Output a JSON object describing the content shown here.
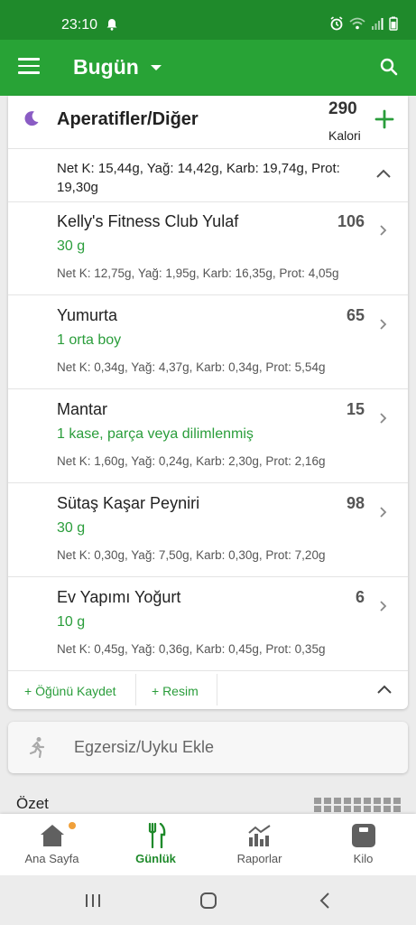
{
  "status_bar": {
    "time": "23:10"
  },
  "app_bar": {
    "title": "Bugün"
  },
  "meal": {
    "name": "Aperatifler/Diğer",
    "calories": "290",
    "calories_unit": "Kalori",
    "summary": "Net K: 15,44g, Yağ: 14,42g, Karb: 19,74g, Prot: 19,30g",
    "items": [
      {
        "name": "Kelly's Fitness Club Yulaf",
        "calories": "106",
        "quantity": "30  g",
        "macros": "Net K: 12,75g, Yağ: 1,95g, Karb: 16,35g, Prot: 4,05g"
      },
      {
        "name": "Yumurta",
        "calories": "65",
        "quantity": "1  orta boy",
        "macros": "Net K: 0,34g, Yağ: 4,37g, Karb: 0,34g, Prot: 5,54g"
      },
      {
        "name": "Mantar",
        "calories": "15",
        "quantity": "1  kase, parça veya dilimlenmiş",
        "macros": "Net K: 1,60g, Yağ: 0,24g, Karb: 2,30g, Prot: 2,16g"
      },
      {
        "name": "Sütaş Kaşar Peyniri",
        "calories": "98",
        "quantity": "30  g",
        "macros": "Net K: 0,30g, Yağ: 7,50g, Karb: 0,30g, Prot: 7,20g"
      },
      {
        "name": "Ev Yapımı Yoğurt",
        "calories": "6",
        "quantity": "10  g",
        "macros": "Net K: 0,45g, Yağ: 0,36g, Karb: 0,45g, Prot: 0,35g"
      }
    ],
    "save_meal_label": "+ Öğünü Kaydet",
    "add_photo_label": "+ Resim"
  },
  "exercise": {
    "label": "Egzersiz/Uyku Ekle"
  },
  "summary_section": {
    "title": "Özet"
  },
  "bottom_nav": {
    "tabs": [
      {
        "label": "Ana Sayfa",
        "icon": "home-icon"
      },
      {
        "label": "Günlük",
        "icon": "utensils-icon",
        "active": true
      },
      {
        "label": "Raporlar",
        "icon": "chart-icon"
      },
      {
        "label": "Kilo",
        "icon": "scale-icon"
      }
    ]
  },
  "colors": {
    "status_bar": "#1f8a2b",
    "app_bar": "#28a336",
    "accent_green": "#2a9d3b",
    "moon_purple": "#8a5cc4",
    "notification_dot": "#f0a03a"
  }
}
